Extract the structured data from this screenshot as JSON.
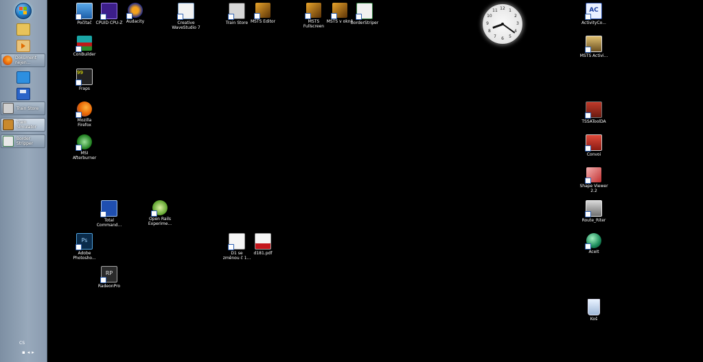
{
  "taskbar": {
    "buttons": [
      {
        "label": "Dokument nejen..."
      },
      {
        "label": "Train Store"
      },
      {
        "label": "Train Simulator"
      },
      {
        "label": "Border Stripper"
      }
    ],
    "language": "CS"
  },
  "desktop": {
    "icons": [
      {
        "label": "Počítač",
        "icon": "computer-icon"
      },
      {
        "label": "CPUID CPU-Z",
        "icon": "cpu-icon"
      },
      {
        "label": "Audacity",
        "icon": "audacity-icon"
      },
      {
        "label": "Creative WaveStudio 7",
        "icon": "wavestudio-icon"
      },
      {
        "label": "Train Store",
        "icon": "train-store-icon"
      },
      {
        "label": "MSTS Editor",
        "icon": "msts-editor-icon"
      },
      {
        "label": "MSTS Fullscreen",
        "icon": "msts-fullscreen-icon"
      },
      {
        "label": "MSTS v okně",
        "icon": "msts-window-icon"
      },
      {
        "label": "BorderStriper",
        "icon": "borderstriper-icon"
      },
      {
        "label": "ConBuilder",
        "icon": "conbuilder-icon"
      },
      {
        "label": "Fraps",
        "icon": "fraps-icon"
      },
      {
        "label": "Mozilla Firefox",
        "icon": "firefox-icon"
      },
      {
        "label": "MSI Afterburner",
        "icon": "afterburner-icon"
      },
      {
        "label": "Total Command...",
        "icon": "total-commander-icon"
      },
      {
        "label": "Open Rails Experime...",
        "icon": "open-rails-icon"
      },
      {
        "label": "Adobe Photosho...",
        "icon": "photoshop-icon"
      },
      {
        "label": "D1 se změnou č 1...",
        "icon": "document-icon"
      },
      {
        "label": "d181.pdf",
        "icon": "pdf-icon"
      },
      {
        "label": "RadeonPro",
        "icon": "radeonpro-icon"
      },
      {
        "label": "ActivityCo...",
        "icon": "activity-creator-icon"
      },
      {
        "label": "MSTS Activi...",
        "icon": "msts-activity-icon"
      },
      {
        "label": "TSSAToolDA",
        "icon": "tssatool-icon"
      },
      {
        "label": "Convoi",
        "icon": "convoi-icon"
      },
      {
        "label": "Shape Viewer 2.2",
        "icon": "shape-viewer-icon"
      },
      {
        "label": "Route_Riter",
        "icon": "route-riter-icon"
      },
      {
        "label": "AceIt",
        "icon": "aceit-icon"
      },
      {
        "label": "Koš",
        "icon": "recycle-bin-icon"
      }
    ]
  },
  "clock": {
    "numbers": [
      "12",
      "1",
      "2",
      "3",
      "4",
      "5",
      "6",
      "7",
      "8",
      "9",
      "10",
      "11"
    ],
    "hour": 8,
    "minute": 21
  }
}
